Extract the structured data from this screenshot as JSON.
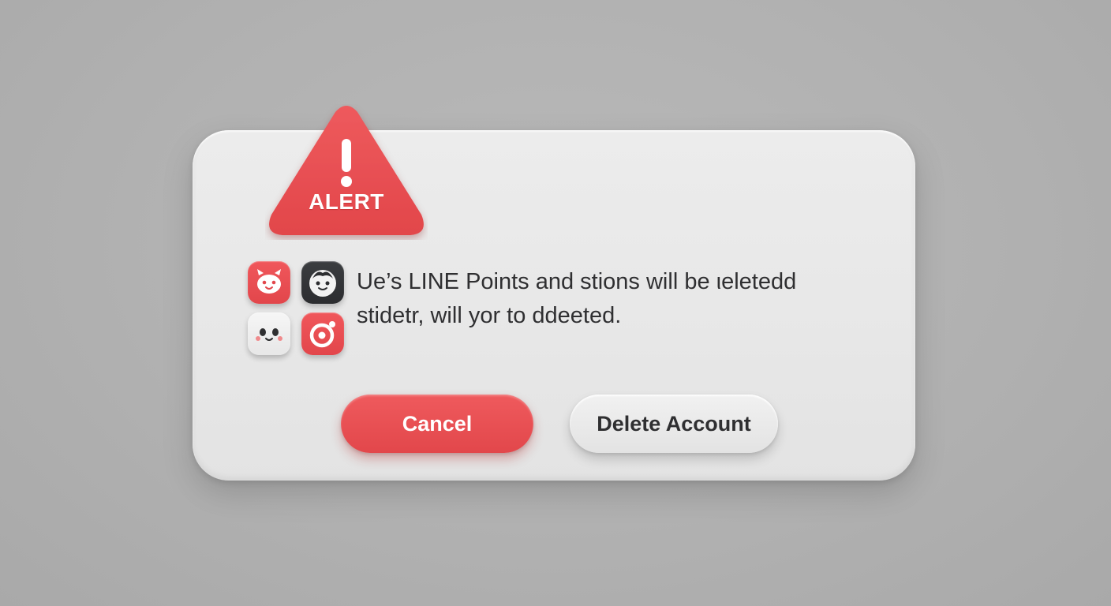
{
  "dialog": {
    "alert_label": "ALERT",
    "alert_icon": "exclamation-triangle-icon",
    "message_lines": [
      "Ue’s LINE Points and stions will be ιeletedd",
      "stidetr, will yor to ddeeted."
    ],
    "app_icons": [
      {
        "name": "bear-face-icon",
        "color": "#e84a4f"
      },
      {
        "name": "smiley-face-icon",
        "color": "#2f3033"
      },
      {
        "name": "panda-face-icon",
        "color": "#eeeeee"
      },
      {
        "name": "target-icon",
        "color": "#e84a4f"
      }
    ],
    "cancel_label": "Cancel",
    "delete_label": "Delete Account"
  },
  "colors": {
    "accent": "#e84a4f",
    "background": "#b4b4b4",
    "card": "#e9e9e9",
    "text": "#2f2f31"
  }
}
